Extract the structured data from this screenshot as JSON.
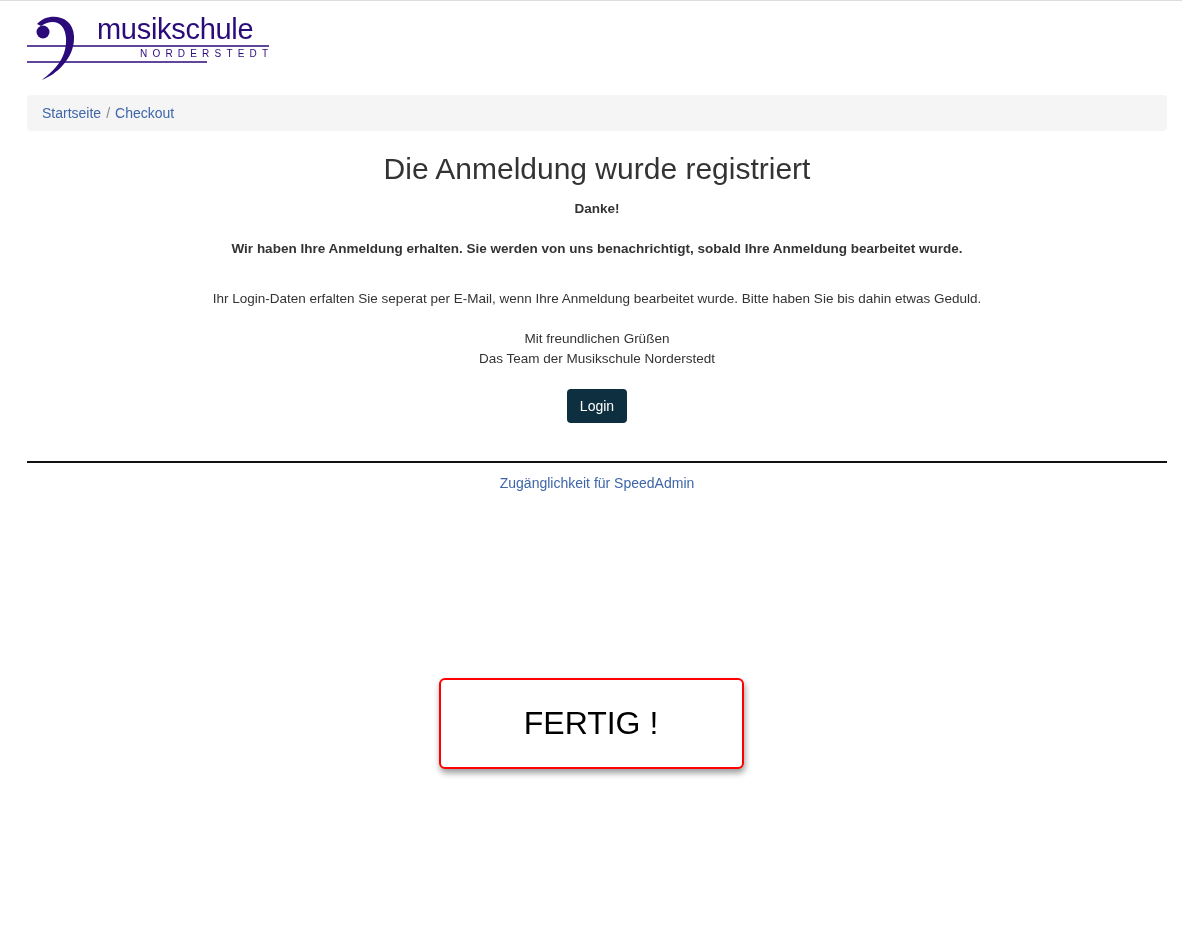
{
  "logo": {
    "name": "musikschule",
    "place": "NORDERSTEDT"
  },
  "breadcrumb": [
    {
      "label": "Startseite"
    },
    {
      "label": "Checkout"
    }
  ],
  "breadcrumb_separator": "/",
  "heading": "Die Anmeldung wurde registriert",
  "thanks": "Danke!",
  "confirmation": "Wir haben Ihre Anmeldung erhalten. Sie werden von uns benachrichtigt, sobald Ihre Anmeldung bearbeitet wurde.",
  "info": "Ihr Login-Daten erfalten Sie seperat per E-Mail, wenn Ihre Anmeldung bearbeitet wurde. Bitte haben Sie bis dahin etwas Geduld.",
  "greeting": [
    "Mit freundlichen Grüßen",
    "Das Team der Musikschule Norderstedt"
  ],
  "login_button": "Login",
  "footer_link": "Zugänglichkeit für SpeedAdmin",
  "callout": "FERTIG !"
}
